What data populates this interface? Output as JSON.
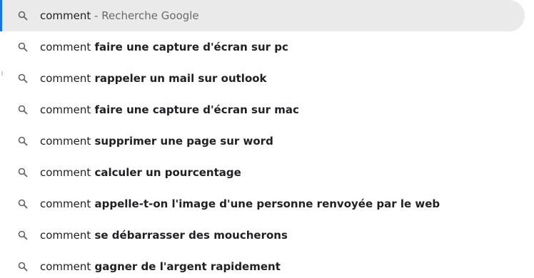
{
  "accent_color": "#1a73e8",
  "selected_row_bg": "#eaeaea",
  "icon": "search-icon",
  "suggestions": [
    {
      "prefix": "comment",
      "suffix": " - Recherche Google",
      "selected": true
    },
    {
      "prefix": "comment",
      "suffix": " faire une capture d'écran sur pc"
    },
    {
      "prefix": "comment",
      "suffix": " rappeler un mail sur outlook"
    },
    {
      "prefix": "comment",
      "suffix": " faire une capture d'écran sur mac"
    },
    {
      "prefix": "comment",
      "suffix": " supprimer une page sur word"
    },
    {
      "prefix": "comment",
      "suffix": " calculer un pourcentage"
    },
    {
      "prefix": "comment",
      "suffix": " appelle-t-on l'image d'une personne renvoyée par le web"
    },
    {
      "prefix": "comment",
      "suffix": " se débarrasser des moucherons"
    },
    {
      "prefix": "comment",
      "suffix": " gagner de l'argent rapidement"
    }
  ]
}
